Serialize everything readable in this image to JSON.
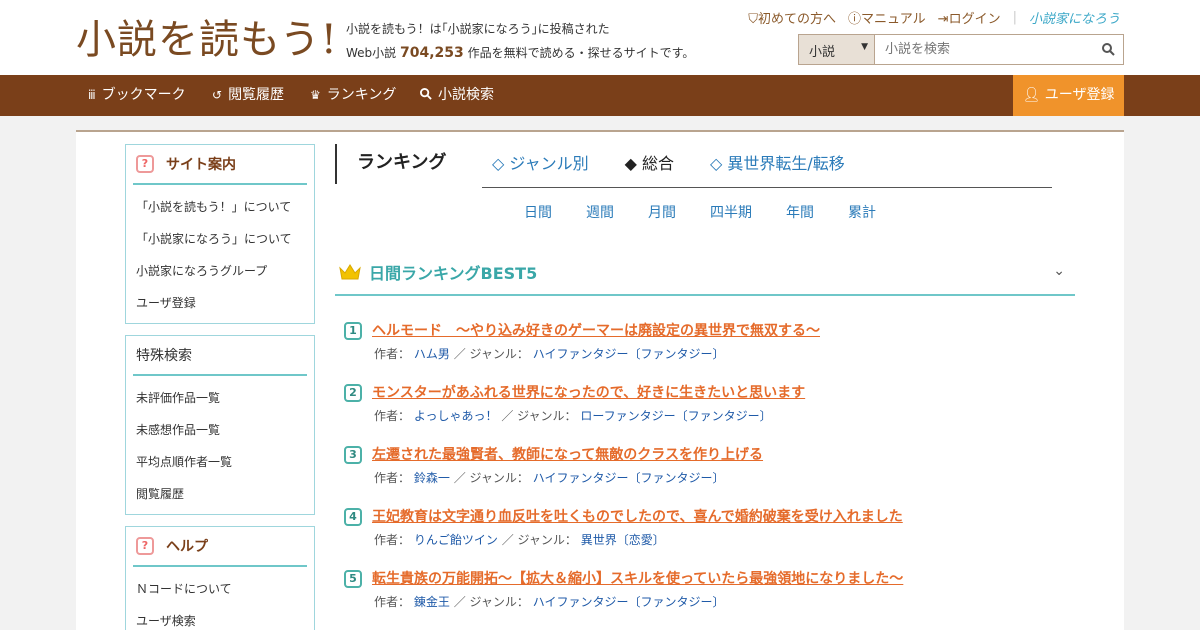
{
  "header": {
    "logo": "小説を読もう!",
    "tagline_line1": "小説を読もう！は｢小説家になろう｣に投稿された",
    "tagline_prefix": "Web小説",
    "work_count": "704,253",
    "tagline_suffix": "作品を無料で読める・探せるサイトです。",
    "links": {
      "beginner": "初めての方へ",
      "manual": "マニュアル",
      "login": "ログイン",
      "narou_logo": "小説家になろう"
    },
    "search": {
      "category": "小説",
      "placeholder": "小説を検索"
    }
  },
  "nav": {
    "bookmark": "ブックマーク",
    "history": "閲覧履歴",
    "ranking": "ランキング",
    "search": "小説検索",
    "signup": "ユーザ登録"
  },
  "sidebar": {
    "site_guide": {
      "title": "サイト案内",
      "items": [
        "「小説を読もう！」について",
        "「小説家になろう」について",
        "小説家になろうグループ",
        "ユーザ登録"
      ]
    },
    "special_search": {
      "title": "特殊検索",
      "items": [
        "未評価作品一覧",
        "未感想作品一覧",
        "平均点順作者一覧",
        "閲覧履歴"
      ]
    },
    "help": {
      "title": "ヘルプ",
      "items": [
        "Ｎコードについて",
        "ユーザ検索"
      ]
    }
  },
  "ranking": {
    "heading": "ランキング",
    "tabs": [
      "◇ ジャンル別",
      "◆ 総合",
      "◇ 異世界転生/転移"
    ],
    "periods": [
      "日間",
      "週間",
      "月間",
      "四半期",
      "年間",
      "累計"
    ],
    "best_title": "日間ランキングBEST5",
    "author_label": "作者：",
    "genre_label": "／ ジャンル：",
    "entries": [
      {
        "rank": "1",
        "title": "ヘルモード　～やり込み好きのゲーマーは廃設定の異世界で無双する～",
        "author": "ハム男",
        "genre": "ハイファンタジー〔ファンタジー〕"
      },
      {
        "rank": "2",
        "title": "モンスターがあふれる世界になったので、好きに生きたいと思います",
        "author": "よっしゃあっ！",
        "genre": "ローファンタジー〔ファンタジー〕"
      },
      {
        "rank": "3",
        "title": "左遷された最強賢者、教師になって無敵のクラスを作り上げる",
        "author": "鈴森一",
        "genre": "ハイファンタジー〔ファンタジー〕"
      },
      {
        "rank": "4",
        "title": "王妃教育は文字通り血反吐を吐くものでしたので、喜んで婚約破棄を受け入れました",
        "author": "りんご飴ツイン",
        "genre": "異世界〔恋愛〕"
      },
      {
        "rank": "5",
        "title": "転生貴族の万能開拓～【拡大＆縮小】スキルを使っていたら最強領地になりました～",
        "author": "錬金王",
        "genre": "ハイファンタジー〔ファンタジー〕"
      }
    ]
  },
  "colors": {
    "brand_brown": "#7a3f19",
    "signup_orange": "#f0932b",
    "teal": "#6fc7c9",
    "title_orange": "#e56b2b",
    "link_blue": "#1f5aa8"
  }
}
